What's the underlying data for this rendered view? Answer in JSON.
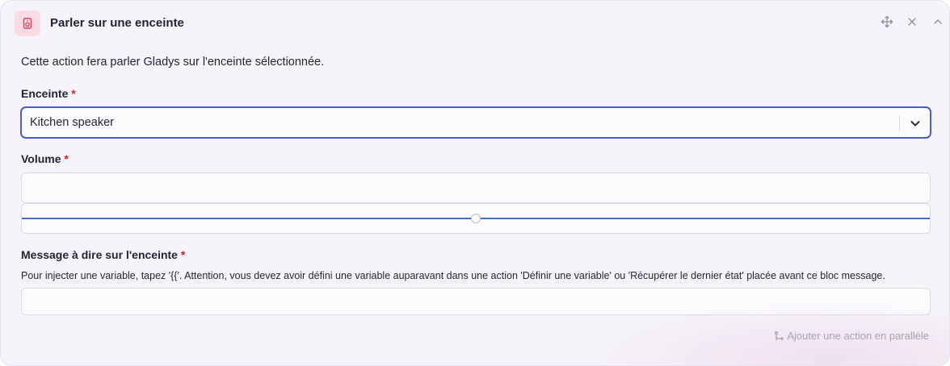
{
  "header": {
    "title": "Parler sur une enceinte",
    "icon": "speaker-icon",
    "actions": [
      "move-icon",
      "close-icon",
      "chevron-up-icon"
    ]
  },
  "description": "Cette action fera parler Gladys sur l'enceinte sélectionnée.",
  "speaker_field": {
    "label": "Enceinte",
    "required_mark": "*",
    "selected": "Kitchen speaker"
  },
  "volume_field": {
    "label": "Volume",
    "required_mark": "*",
    "value": "",
    "slider_fraction": 0.5
  },
  "message_field": {
    "label": "Message à dire sur l'enceinte",
    "required_mark": "*",
    "hint": "Pour injecter une variable, tapez '{{'. Attention, vous devez avoir défini une variable auparavant dans une action 'Définir une variable' ou 'Récupérer le dernier état' placée avant ce bloc message.",
    "value": ""
  },
  "footer": {
    "parallel_label": "Ajouter une action en parallèle"
  },
  "colors": {
    "accent": "#4a5fc1",
    "required": "#cd2026",
    "icon_bg": "#fadbe3",
    "icon_fg": "#d0445e"
  }
}
